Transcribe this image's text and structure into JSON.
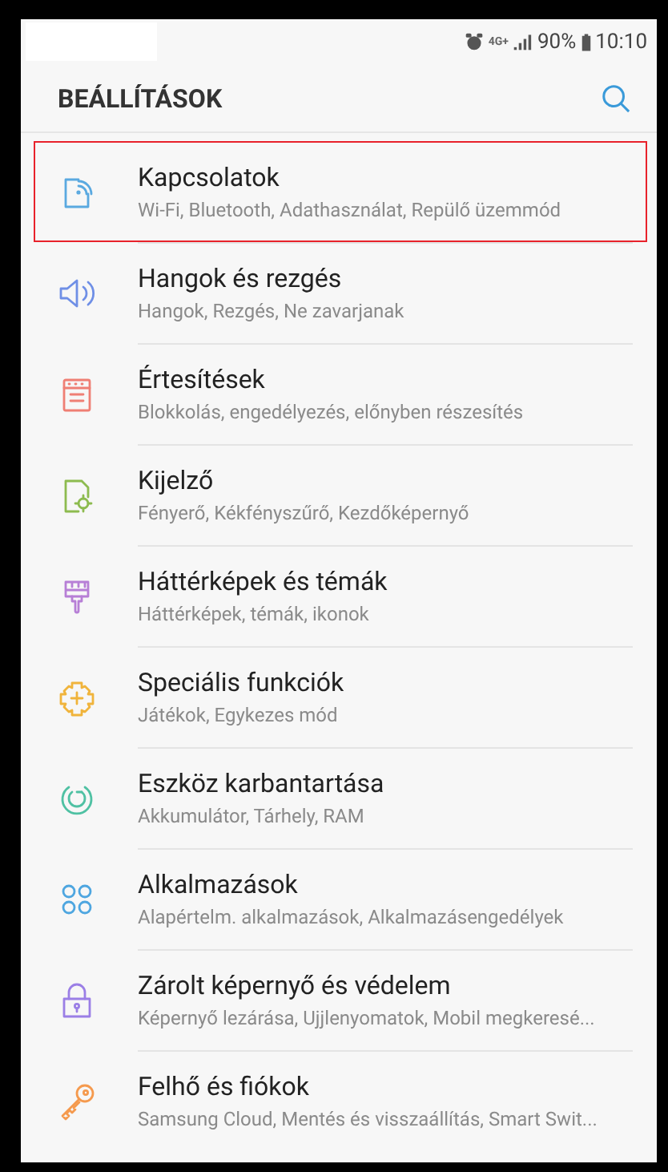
{
  "status_bar": {
    "network": "4G+",
    "battery": "90%",
    "time": "10:10"
  },
  "header": {
    "title": "BEÁLLÍTÁSOK"
  },
  "items": [
    {
      "title": "Kapcsolatok",
      "subtitle": "Wi-Fi, Bluetooth, Adathasználat, Repülő üzemmód",
      "color": "#5aa9e0",
      "highlighted": true
    },
    {
      "title": "Hangok és rezgés",
      "subtitle": "Hangok, Rezgés, Ne zavarjanak",
      "color": "#6f8fe6",
      "highlighted": false
    },
    {
      "title": "Értesítések",
      "subtitle": "Blokkolás, engedélyezés, előnyben részesítés",
      "color": "#ef7f74",
      "highlighted": false
    },
    {
      "title": "Kijelző",
      "subtitle": "Fényerő, Kékfényszűrő, Kezdőképernyő",
      "color": "#8dbb4f",
      "highlighted": false
    },
    {
      "title": "Háttérképek és témák",
      "subtitle": "Háttérképek, témák, ikonok",
      "color": "#b77fd6",
      "highlighted": false
    },
    {
      "title": "Speciális funkciók",
      "subtitle": "Játékok, Egykezes mód",
      "color": "#f0b43c",
      "highlighted": false
    },
    {
      "title": "Eszköz karbantartása",
      "subtitle": "Akkumulátor, Tárhely, RAM",
      "color": "#4fc1a3",
      "highlighted": false
    },
    {
      "title": "Alkalmazások",
      "subtitle": "Alapértelm. alkalmazások, Alkalmazásengedélyek",
      "color": "#4ea6e0",
      "highlighted": false
    },
    {
      "title": "Zárolt képernyő és védelem",
      "subtitle": "Képernyő lezárása, Ujjlenyomatok, Mobil megkeresé...",
      "color": "#9b7fe6",
      "highlighted": false
    },
    {
      "title": "Felhő és fiókok",
      "subtitle": "Samsung Cloud, Mentés és visszaállítás, Smart Swit...",
      "color": "#f59a4e",
      "highlighted": false
    }
  ]
}
